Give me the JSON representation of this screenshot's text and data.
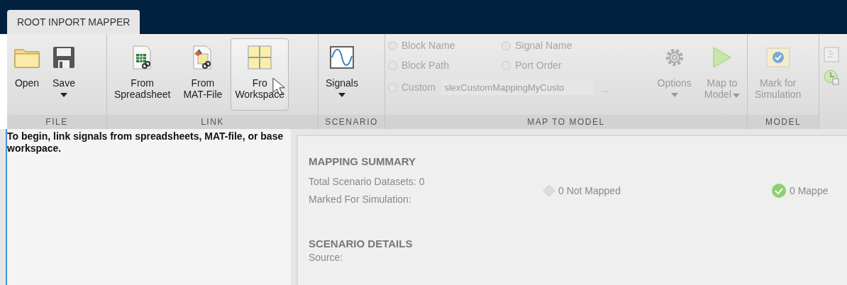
{
  "tab": {
    "label": "ROOT INPORT MAPPER",
    "selected": true
  },
  "groups": [
    {
      "label": "FILE",
      "buttons": [
        {
          "kind": "button",
          "lines": [
            "Open"
          ],
          "disabled": false,
          "hovered": false
        },
        {
          "kind": "menu",
          "lines": [
            "Save"
          ],
          "disabled": false,
          "hovered": false
        }
      ]
    },
    {
      "label": "LINK",
      "buttons": [
        {
          "kind": "button",
          "lines": [
            "From",
            "Spreadsheet"
          ],
          "disabled": false,
          "hovered": false
        },
        {
          "kind": "button",
          "lines": [
            "From",
            "MAT-File"
          ],
          "disabled": false,
          "hovered": false
        },
        {
          "kind": "button",
          "lines": [
            "Fro",
            "Workspace"
          ],
          "disabled": false,
          "hovered": true
        }
      ]
    },
    {
      "label": "SCENARIO",
      "buttons": [
        {
          "kind": "menu",
          "lines": [
            "Signals"
          ],
          "disabled": false,
          "hovered": false
        }
      ]
    },
    {
      "label": "MAP TO MODEL",
      "radios": [
        {
          "label": "Block Name",
          "selected": false,
          "disabled": true
        },
        {
          "label": "Signal Name",
          "selected": false,
          "disabled": true
        },
        {
          "label": "Block Path",
          "selected": false,
          "disabled": true
        },
        {
          "label": "Port Order",
          "selected": false,
          "disabled": true
        },
        {
          "label": "Custom",
          "selected": false,
          "disabled": true
        }
      ],
      "custom_field": {
        "value": "slexCustomMappingMyCusto",
        "disabled": true
      },
      "browse_button": {
        "label": "...",
        "disabled": true
      },
      "buttons": [
        {
          "kind": "menu",
          "lines": [
            "Options"
          ],
          "disabled": true,
          "hovered": false
        },
        {
          "kind": "split",
          "lines": [
            "Map to",
            "Model"
          ],
          "disabled": true,
          "hovered": false
        }
      ]
    },
    {
      "label": "MODEL",
      "buttons": [
        {
          "kind": "button",
          "lines": [
            "Mark for",
            "Simulation"
          ],
          "disabled": true,
          "hovered": false
        }
      ]
    }
  ],
  "instructions": "To begin, link signals from spreadsheets, MAT-file, or base workspace.",
  "summary": {
    "title": "MAPPING SUMMARY",
    "stats": [
      "Total Scenario Datasets: 0",
      "Marked For Simulation:"
    ],
    "statuses": [
      {
        "kind": "not_mapped",
        "label": "0 Not Mapped"
      },
      {
        "kind": "mapped",
        "label": "0 Mappe"
      }
    ]
  },
  "details": {
    "title": "SCENARIO DETAILS",
    "fields": [
      "Source:"
    ]
  }
}
